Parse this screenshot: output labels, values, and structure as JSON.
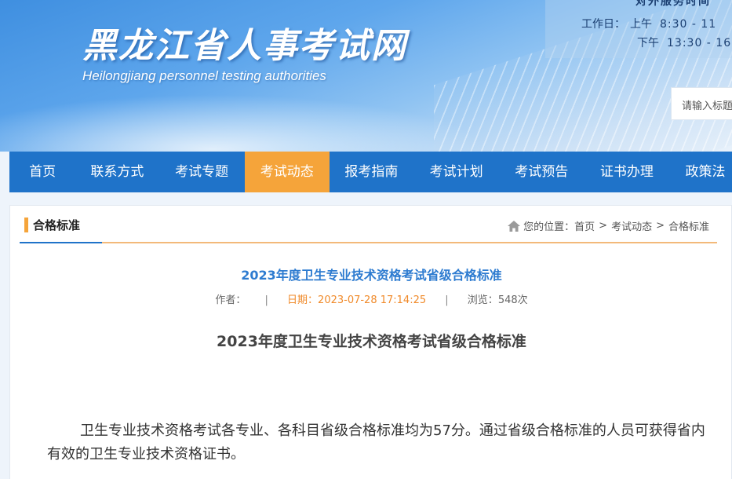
{
  "header": {
    "site_title": "黑龙江省人事考试网",
    "site_subtitle": "Heilongjiang personnel testing authorities",
    "hours_title": "对外服务时间",
    "hours_label": "工作日：",
    "morning_label": "上午",
    "morning_time": "8:30 - 11",
    "afternoon_label": "下午",
    "afternoon_time": "13:30 - 16",
    "search_placeholder": "请输入标题"
  },
  "nav": {
    "items": [
      {
        "label": "首页"
      },
      {
        "label": "联系方式"
      },
      {
        "label": "考试专题"
      },
      {
        "label": "考试动态"
      },
      {
        "label": "报考指南"
      },
      {
        "label": "考试计划"
      },
      {
        "label": "考试预告"
      },
      {
        "label": "证书办理"
      },
      {
        "label": "政策法"
      }
    ],
    "active_index": 3,
    "colors": {
      "bar": "#1f73c9",
      "active": "#f5a43a"
    }
  },
  "panel": {
    "section_title": "合格标准",
    "breadcrumb": {
      "prefix": "您的位置：",
      "items": [
        "首页",
        "考试动态",
        "合格标准"
      ],
      "separator": ">"
    }
  },
  "article": {
    "title": "2023年度卫生专业技术资格考试省级合格标准",
    "author_label": "作者：",
    "date_label": "日期：",
    "date_value": "2023-07-28 17:14:25",
    "views_label": "浏览：",
    "views_value": "548次",
    "body_title": "2023年度卫生专业技术资格考试省级合格标准",
    "body_text": "卫生专业技术资格考试各专业、各科目省级合格标准均为57分。通过省级合格标准的人员可获得省内有效的卫生专业技术资格证书。"
  }
}
